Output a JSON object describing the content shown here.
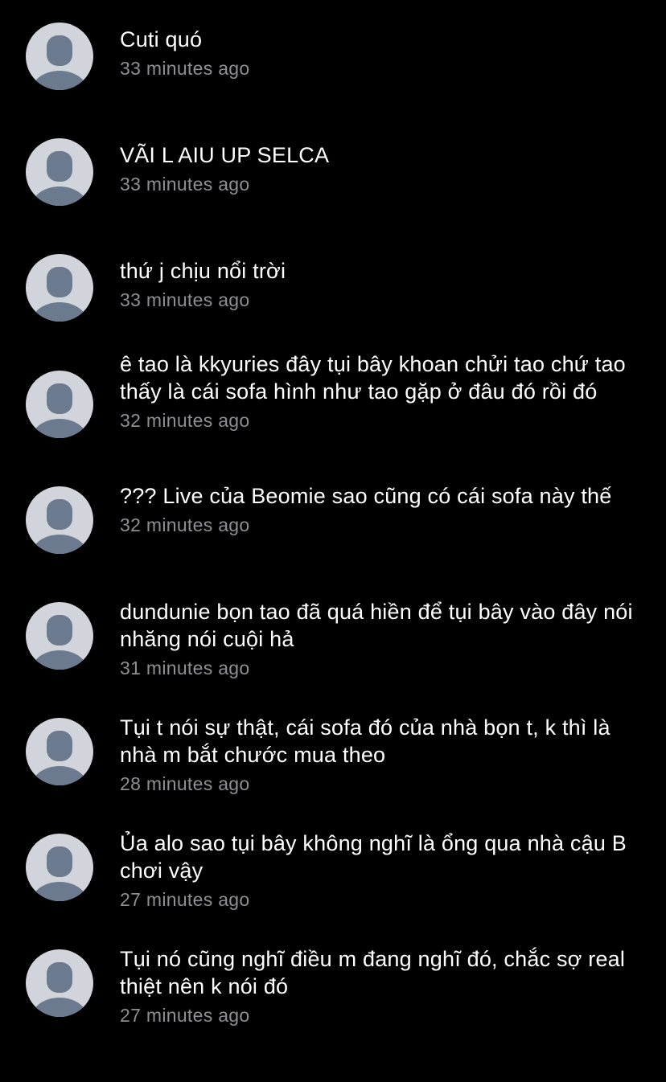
{
  "colors": {
    "background": "#000000",
    "text": "#ffffff",
    "timestamp": "#8e8e93",
    "avatar_bg": "#d1d5db",
    "avatar_fg": "#6b7a8f"
  },
  "comments": [
    {
      "avatar_icon": "default-user-icon",
      "text": "Cuti quó",
      "time": "33 minutes ago"
    },
    {
      "avatar_icon": "default-user-icon",
      "text": "VÃI L AIU UP SELCA",
      "time": "33 minutes ago"
    },
    {
      "avatar_icon": "default-user-icon",
      "text": "thứ j chịu nổi trời",
      "time": "33 minutes ago"
    },
    {
      "avatar_icon": "default-user-icon",
      "text": "ê tao là kkyuries đây tụi bây khoan chửi tao chứ tao thấy là cái sofa hình như tao gặp ở đâu đó rồi đó",
      "time": "32 minutes ago"
    },
    {
      "avatar_icon": "default-user-icon",
      "text": "??? Live của Beomie sao cũng có cái sofa này thế",
      "time": "32 minutes ago"
    },
    {
      "avatar_icon": "default-user-icon",
      "text": "dundunie bọn tao đã quá hiền để tụi bây vào đây nói nhăng nói cuội hả",
      "time": "31 minutes ago"
    },
    {
      "avatar_icon": "default-user-icon",
      "text": "Tụi t nói sự thật, cái sofa đó của nhà bọn t, k thì là nhà m bắt chước mua theo",
      "time": "28 minutes ago"
    },
    {
      "avatar_icon": "default-user-icon",
      "text": "Ủa alo sao tụi bây không nghĩ là ổng qua nhà cậu B chơi vậy",
      "time": "27 minutes ago"
    },
    {
      "avatar_icon": "default-user-icon",
      "text": "Tụi nó cũng nghĩ điều m đang nghĩ đó, chắc sợ real thiệt nên k nói đó",
      "time": "27 minutes ago"
    }
  ]
}
